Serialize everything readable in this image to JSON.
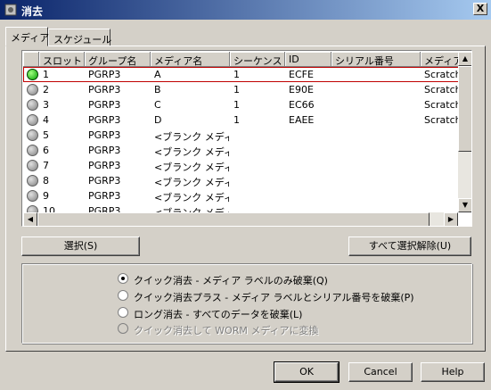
{
  "window": {
    "title": "消去",
    "close_symbol": "X",
    "app_icon": "app-gear-icon"
  },
  "tabs": [
    {
      "label": "メディア",
      "active": true
    },
    {
      "label": "スケジュール",
      "active": false
    }
  ],
  "table": {
    "headers": [
      "",
      "スロット",
      "グループ名",
      "メディア名",
      "シーケンス",
      "ID",
      "シリアル番号",
      "メディア ブー"
    ],
    "rows": [
      {
        "status": "green",
        "slot": "1",
        "group": "PGRP3",
        "media": "A",
        "seq": "1",
        "id": "ECFE",
        "serial": "",
        "pool": "Scratch"
      },
      {
        "status": "gray",
        "slot": "2",
        "group": "PGRP3",
        "media": "B",
        "seq": "1",
        "id": "E90E",
        "serial": "",
        "pool": "Scratch"
      },
      {
        "status": "gray",
        "slot": "3",
        "group": "PGRP3",
        "media": "C",
        "seq": "1",
        "id": "EC66",
        "serial": "",
        "pool": "Scratch"
      },
      {
        "status": "gray",
        "slot": "4",
        "group": "PGRP3",
        "media": "D",
        "seq": "1",
        "id": "EAEE",
        "serial": "",
        "pool": "Scratch"
      },
      {
        "status": "gray",
        "slot": "5",
        "group": "PGRP3",
        "media": "<ブランク メディア>",
        "seq": "",
        "id": "",
        "serial": "",
        "pool": ""
      },
      {
        "status": "gray",
        "slot": "6",
        "group": "PGRP3",
        "media": "<ブランク メディア>",
        "seq": "",
        "id": "",
        "serial": "",
        "pool": ""
      },
      {
        "status": "gray",
        "slot": "7",
        "group": "PGRP3",
        "media": "<ブランク メディア>",
        "seq": "",
        "id": "",
        "serial": "",
        "pool": ""
      },
      {
        "status": "gray",
        "slot": "8",
        "group": "PGRP3",
        "media": "<ブランク メディア>",
        "seq": "",
        "id": "",
        "serial": "",
        "pool": ""
      },
      {
        "status": "gray",
        "slot": "9",
        "group": "PGRP3",
        "media": "<ブランク メディア>",
        "seq": "",
        "id": "",
        "serial": "",
        "pool": ""
      },
      {
        "status": "gray",
        "slot": "10",
        "group": "PGRP3",
        "media": "<ブランク メディア>",
        "seq": "",
        "id": "",
        "serial": "",
        "pool": ""
      }
    ],
    "selected_row": 0
  },
  "buttons": {
    "select": "選択(S)",
    "deselect_all": "すべて選択解除(U)",
    "ok": "OK",
    "cancel": "Cancel",
    "help": "Help"
  },
  "erase_options": [
    {
      "label": "クイック消去 - メディア ラベルのみ破棄(Q)",
      "checked": true,
      "disabled": false
    },
    {
      "label": "クイック消去プラス - メディア ラベルとシリアル番号を破棄(P)",
      "checked": false,
      "disabled": false
    },
    {
      "label": "ロング消去 - すべてのデータを破棄(L)",
      "checked": false,
      "disabled": false
    },
    {
      "label": "クイック消去して WORM メディアに変換",
      "checked": false,
      "disabled": true
    }
  ],
  "colors": {
    "selection_outline": "#c00000",
    "status_on": "#00a000",
    "status_off": "#808080"
  }
}
